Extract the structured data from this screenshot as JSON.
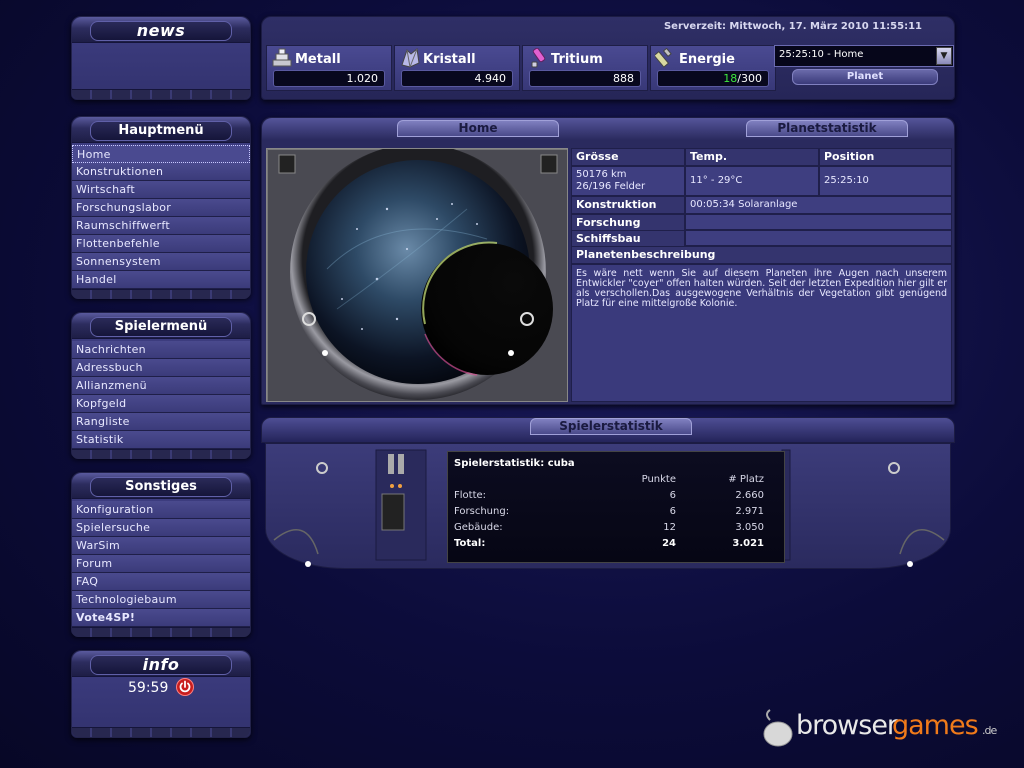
{
  "news": {
    "title": "news"
  },
  "hauptmenu": {
    "title": "Hauptmenü",
    "items": [
      "Home",
      "Konstruktionen",
      "Wirtschaft",
      "Forschungslabor",
      "Raumschiffwerft",
      "Flottenbefehle",
      "Sonnensystem",
      "Handel"
    ]
  },
  "spielermenu": {
    "title": "Spielermenü",
    "items": [
      "Nachrichten",
      "Adressbuch",
      "Allianzmenü",
      "Kopfgeld",
      "Rangliste",
      "Statistik"
    ]
  },
  "sonstiges": {
    "title": "Sonstiges",
    "items": [
      "Konfiguration",
      "Spielersuche",
      "WarSim",
      "Forum",
      "FAQ",
      "Technologiebaum",
      "Vote4SP!"
    ]
  },
  "info": {
    "title": "info",
    "timer": "59:59"
  },
  "topbar": {
    "servertime": "Serverzeit: Mittwoch, 17. März 2010 11:55:11",
    "resources": [
      {
        "name": "Metall",
        "value": "1.020",
        "icon": "metal-icon"
      },
      {
        "name": "Kristall",
        "value": "4.940",
        "icon": "crystal-icon"
      },
      {
        "name": "Tritium",
        "value": "888",
        "icon": "tritium-icon"
      },
      {
        "name": "Energie",
        "value_used": "18",
        "value_total": "/300",
        "icon": "energy-icon"
      }
    ],
    "planet_select": "25:25:10 - Home",
    "planet_button": "Planet"
  },
  "home": {
    "tab_home": "Home",
    "tab_stats": "Planetstatistik",
    "headers": {
      "size": "Grösse",
      "temp": "Temp.",
      "position": "Position"
    },
    "size_km": "50176 km",
    "size_fields": "26/196 Felder",
    "temp": "11° -  29°C",
    "position": "25:25:10",
    "konstruktion_label": "Konstruktion",
    "konstruktion_value": "00:05:34 Solaranlage",
    "forschung_label": "Forschung",
    "schiffsbau_label": "Schiffsbau",
    "desc_title": "Planetenbeschreibung",
    "desc_text": "Es wäre nett wenn Sie auf diesem Planeten ihre Augen nach unserem Entwickler \"coyer\" offen halten würden. Seit der letzten Expedition hier gilt er als verschollen.Das ausgewogene Verhältnis der Vegetation gibt genügend Platz für eine mittelgroße Kolonie."
  },
  "playerstats": {
    "bar_title": "Spielerstatistik",
    "title": "Spielerstatistik: cuba",
    "col_points": "Punkte",
    "col_rank": "# Platz",
    "rows": [
      {
        "label": "Flotte:",
        "points": "6",
        "rank": "2.660"
      },
      {
        "label": "Forschung:",
        "points": "6",
        "rank": "2.971"
      },
      {
        "label": "Gebäude:",
        "points": "12",
        "rank": "3.050"
      }
    ],
    "total": {
      "label": "Total:",
      "points": "24",
      "rank": "3.021"
    }
  },
  "watermark": {
    "part1": "browser",
    "part2": "games",
    "suffix": ".de"
  },
  "colors": {
    "accent_green": "#3ee83e",
    "watermark_orange": "#f07a1a",
    "panel": "#3e3e82"
  }
}
